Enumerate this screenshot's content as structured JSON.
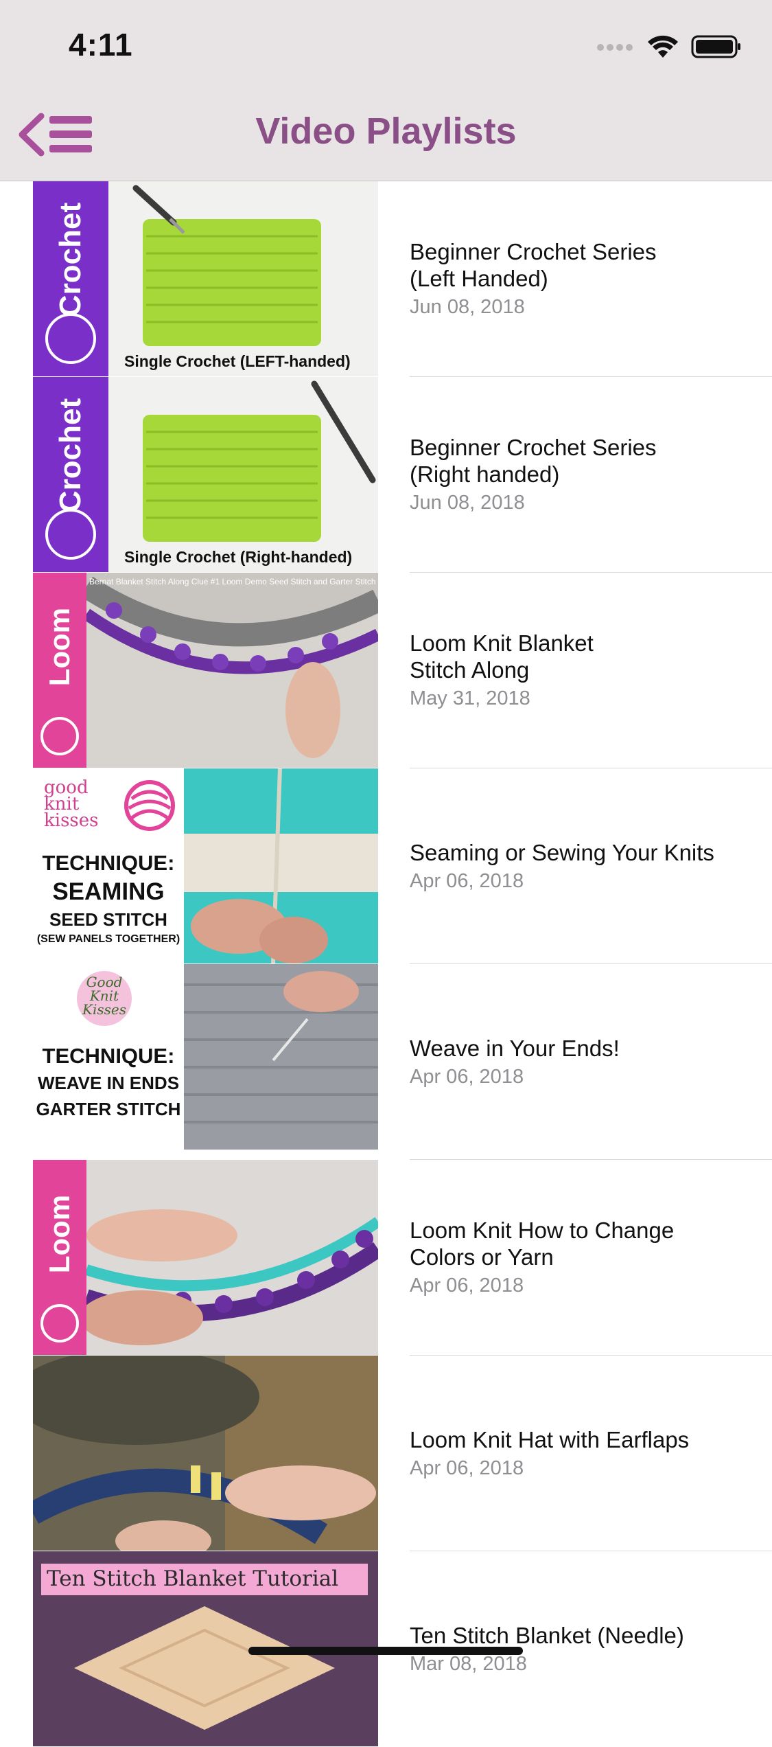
{
  "status_bar": {
    "time": "4:11"
  },
  "nav": {
    "title": "Video Playlists",
    "accent_color": "#8a4f86"
  },
  "playlists": [
    {
      "title": "Beginner Crochet Series\n(Left Handed)",
      "date": "Jun 08, 2018",
      "thumb": {
        "strip_label": "Crochet",
        "caption": "Single Crochet  (LEFT-handed)",
        "strip_color": "#7b2fc9",
        "main_color": "#a6d83a"
      }
    },
    {
      "title": "Beginner Crochet Series\n(Right handed)",
      "date": "Jun 08, 2018",
      "thumb": {
        "strip_label": "Crochet",
        "caption": "Single Crochet  (Right-handed)",
        "strip_color": "#7b2fc9",
        "main_color": "#a6d83a"
      }
    },
    {
      "title": "Loom Knit Blanket\nStitch Along",
      "date": "May 31, 2018",
      "thumb": {
        "strip_label": "Loom",
        "caption": "Bernat Blanket Stitch Along Clue #1 Loom Demo Seed Stitch and Garter Stitch",
        "strip_color": "#e2449a",
        "main_color": "#8c8c8c"
      }
    },
    {
      "title": "Seaming or Sewing Your Knits",
      "date": "Apr 06, 2018",
      "thumb": {
        "brand": "good\nknit\nkisses",
        "heading": "TECHNIQUE:",
        "line1": "SEAMING",
        "line2": "SEED STITCH",
        "line3": "(SEW PANELS TOGETHER)",
        "main_color": "#3cc7c3"
      }
    },
    {
      "title": "Weave in Your Ends!",
      "date": "Apr 06, 2018",
      "thumb": {
        "brand": "Good\nKnit\nKisses",
        "heading": "TECHNIQUE:",
        "line1": "WEAVE IN ENDS",
        "line2": "GARTER STITCH",
        "main_color": "#9a9ca3"
      }
    },
    {
      "title": "Loom Knit How to Change\nColors or Yarn",
      "date": "Apr 06, 2018",
      "thumb": {
        "strip_label": "Loom",
        "strip_color": "#e2449a",
        "main_color": "#d8d5d3"
      }
    },
    {
      "title": "Loom Knit Hat with Earflaps",
      "date": "Apr 06, 2018",
      "thumb": {
        "main_color": "#5b5a48"
      }
    },
    {
      "title": "Ten Stitch Blanket (Needle)",
      "date": "Mar 08, 2018",
      "thumb": {
        "caption": "Ten Stitch Blanket Tutorial",
        "main_color": "#5a3f5e"
      }
    }
  ]
}
